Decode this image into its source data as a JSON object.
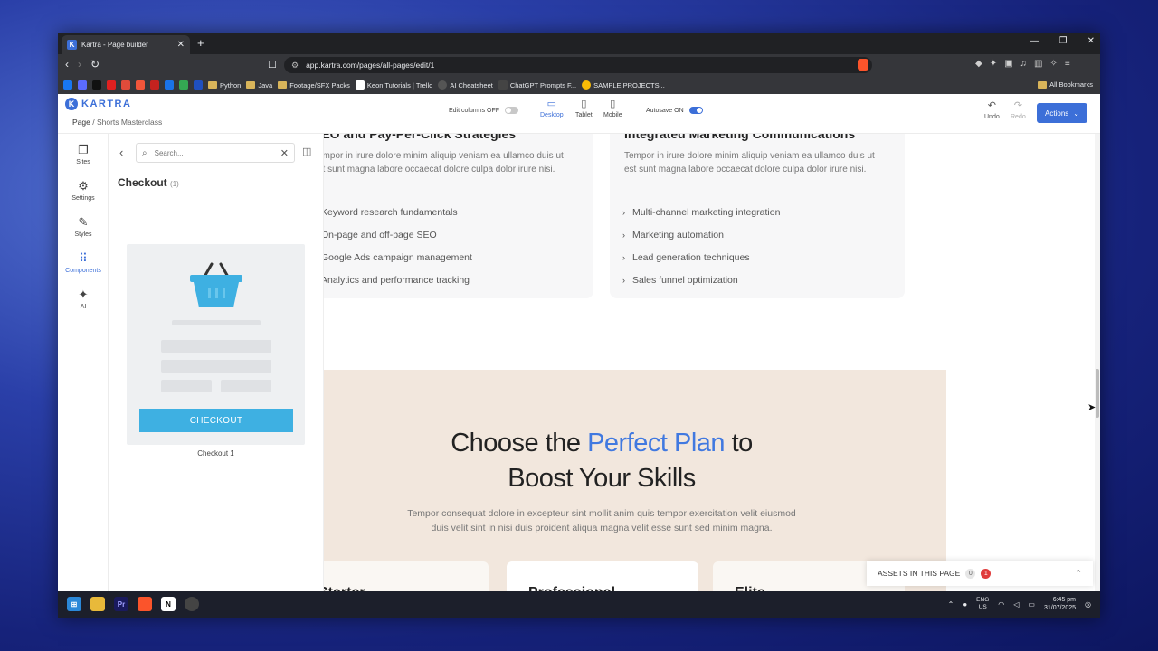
{
  "browser": {
    "tab_title": "Kartra - Page builder",
    "url": "app.kartra.com/pages/all-pages/edit/1",
    "bookmarks": [
      "Python",
      "Java",
      "Footage/SFX Packs",
      "Keon Tutorials | Trello",
      "AI Cheatsheet",
      "ChatGPT Prompts F...",
      "SAMPLE PROJECTS..."
    ],
    "all_bookmarks": "All Bookmarks"
  },
  "header": {
    "logo": "KARTRA",
    "breadcrumb_root": "Page",
    "breadcrumb_sep": " / ",
    "breadcrumb_page": "Shorts Masterclass",
    "edit_columns": "Edit columns OFF",
    "devices": [
      "Desktop",
      "Tablet",
      "Mobile"
    ],
    "autosave": "Autosave ON",
    "undo": "Undo",
    "redo": "Redo",
    "actions": "Actions"
  },
  "rail": [
    "Sites",
    "Settings",
    "Styles",
    "Components",
    "AI"
  ],
  "panel": {
    "search_placeholder": "Search...",
    "title": "Checkout",
    "count": "(1)",
    "button": "CHECKOUT",
    "caption": "Checkout 1"
  },
  "canvas": {
    "left_card": {
      "title": "SEO and Pay-Per-Click Strategies",
      "text": "Tempor in irure dolore minim aliquip veniam ea ullamco duis ut est sunt magna labore occaecat dolore culpa dolor irure nisi.",
      "items": [
        "Keyword research fundamentals",
        "On-page and off-page SEO",
        "Google Ads campaign management",
        "Analytics and performance tracking"
      ]
    },
    "right_card": {
      "title": "Integrated Marketing Communications",
      "text": "Tempor in irure dolore minim aliquip veniam ea ullamco duis ut est sunt magna labore occaecat dolore culpa dolor irure nisi.",
      "items": [
        "Multi-channel marketing integration",
        "Marketing automation",
        "Lead generation techniques",
        "Sales funnel optimization"
      ]
    },
    "pricing": {
      "title_a": "Choose the ",
      "title_b": "Perfect",
      "title_c": "Plan",
      "title_d": " to",
      "title_line2": "Boost Your Skills",
      "subtitle": "Tempor consequat dolore in excepteur sint mollit anim quis tempor exercitation velit eiusmod duis velit sint in nisi duis proident aliqua magna velit esse sunt sed minim magna.",
      "plans": [
        "Starter",
        "Professional",
        "Elite"
      ]
    }
  },
  "assets": {
    "label": "ASSETS IN THIS PAGE",
    "count": "0",
    "errors": "1"
  },
  "taskbar": {
    "lang1": "ENG",
    "lang2": "US",
    "time": "6:45 pm",
    "date": "31/07/2025"
  },
  "colors": {
    "accent": "#3c6fd8",
    "checkout_button": "#3eb0e2",
    "pricing_bg": "#f2e7dd",
    "title_blue": "#4179e0"
  }
}
